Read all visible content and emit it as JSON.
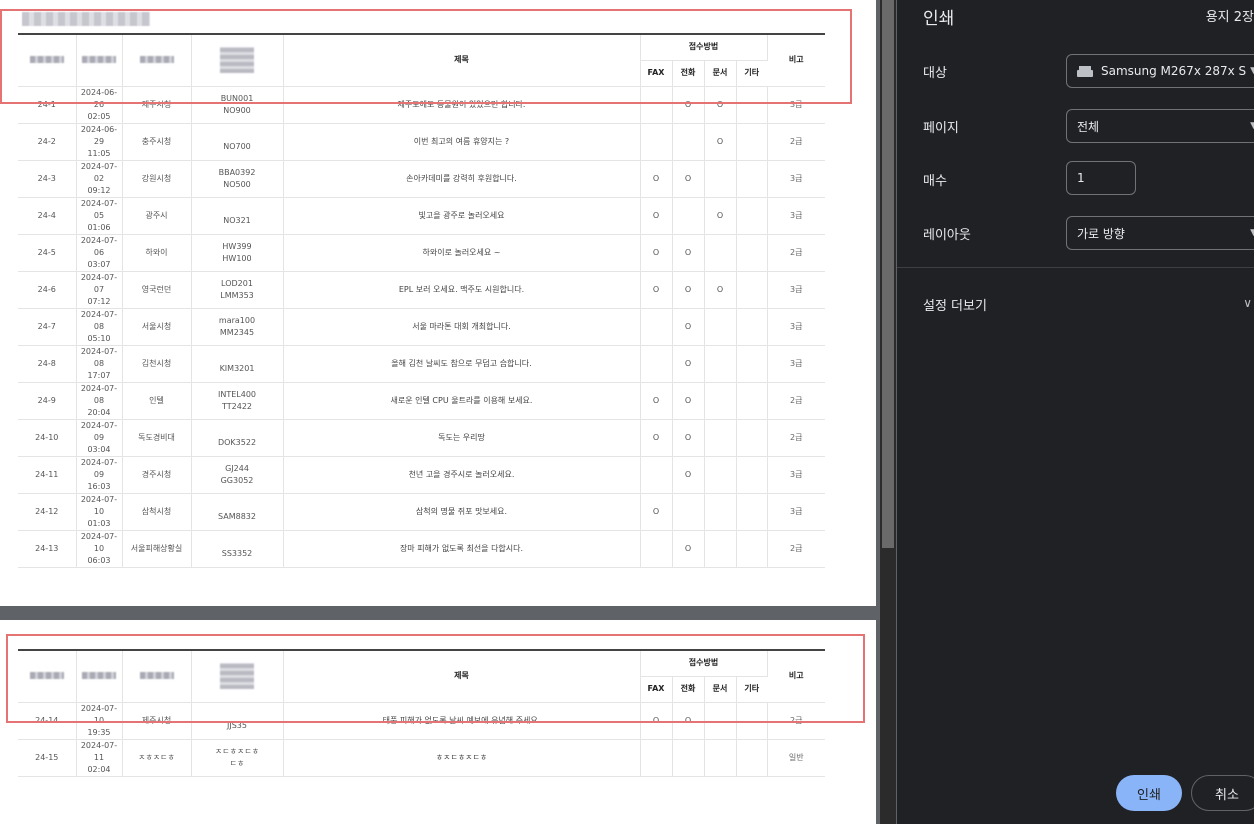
{
  "document": {
    "columns": {
      "title": "제목",
      "receipt_method": "접수방법",
      "methods": [
        "FAX",
        "전화",
        "문서",
        "기타"
      ],
      "note": "비고"
    },
    "rows_page1": [
      {
        "no": "24-1",
        "date": "2024-06-26",
        "time": "02:05",
        "org": "제주시청",
        "code1": "BUN001",
        "code2": "NO900",
        "title": "제주도에도 동물원이 있었으면 합니다.",
        "fax": "",
        "tel": "O",
        "doc": "O",
        "etc": "",
        "grade": "3급"
      },
      {
        "no": "24-2",
        "date": "2024-06-29",
        "time": "11:05",
        "org": "충주시청",
        "code1": "",
        "code2": "NO700",
        "title": "이번 최고의 여름 휴양지는 ?",
        "fax": "",
        "tel": "",
        "doc": "O",
        "etc": "",
        "grade": "2급"
      },
      {
        "no": "24-3",
        "date": "2024-07-02",
        "time": "09:12",
        "org": "강원시청",
        "code1": "BBA0392",
        "code2": "NO500",
        "title": "손아카데미를 강력히 후원합니다.",
        "fax": "O",
        "tel": "O",
        "doc": "",
        "etc": "",
        "grade": "3급"
      },
      {
        "no": "24-4",
        "date": "2024-07-05",
        "time": "01:06",
        "org": "광주시",
        "code1": "",
        "code2": "NO321",
        "title": "빛고을 광주로 놀러오세요",
        "fax": "O",
        "tel": "",
        "doc": "O",
        "etc": "",
        "grade": "3급"
      },
      {
        "no": "24-5",
        "date": "2024-07-06",
        "time": "03:07",
        "org": "하와이",
        "code1": "HW399",
        "code2": "HW100",
        "title": "하와이로 놀러오세요 ~",
        "fax": "O",
        "tel": "O",
        "doc": "",
        "etc": "",
        "grade": "2급"
      },
      {
        "no": "24-6",
        "date": "2024-07-07",
        "time": "07:12",
        "org": "영국런던",
        "code1": "LOD201",
        "code2": "LMM353",
        "title": "EPL 보러 오세요. 맥주도 시원합니다.",
        "fax": "O",
        "tel": "O",
        "doc": "O",
        "etc": "",
        "grade": "3급"
      },
      {
        "no": "24-7",
        "date": "2024-07-08",
        "time": "05:10",
        "org": "서울시청",
        "code1": "mara100",
        "code2": "MM2345",
        "title": "서울 마라톤 대회 개최합니다.",
        "fax": "",
        "tel": "O",
        "doc": "",
        "etc": "",
        "grade": "3급"
      },
      {
        "no": "24-8",
        "date": "2024-07-08",
        "time": "17:07",
        "org": "김천시청",
        "code1": "",
        "code2": "KIM3201",
        "title": "올해 김천 날씨도 참으로 무덥고 습합니다.",
        "fax": "",
        "tel": "O",
        "doc": "",
        "etc": "",
        "grade": "3급"
      },
      {
        "no": "24-9",
        "date": "2024-07-08",
        "time": "20:04",
        "org": "인텔",
        "code1": "INTEL400",
        "code2": "TT2422",
        "title": "새로운 인텔 CPU 울트라를 이용해 보세요.",
        "fax": "O",
        "tel": "O",
        "doc": "",
        "etc": "",
        "grade": "2급"
      },
      {
        "no": "24-10",
        "date": "2024-07-09",
        "time": "03:04",
        "org": "독도경비대",
        "code1": "",
        "code2": "DOK3522",
        "title": "독도는 우리땅",
        "fax": "O",
        "tel": "O",
        "doc": "",
        "etc": "",
        "grade": "2급"
      },
      {
        "no": "24-11",
        "date": "2024-07-09",
        "time": "16:03",
        "org": "경주시청",
        "code1": "GJ244",
        "code2": "GG3052",
        "title": "천년 고을 경주시로 놀러오세요.",
        "fax": "",
        "tel": "O",
        "doc": "",
        "etc": "",
        "grade": "3급"
      },
      {
        "no": "24-12",
        "date": "2024-07-10",
        "time": "01:03",
        "org": "삼척시청",
        "code1": "",
        "code2": "SAM8832",
        "title": "삼척의 명물 쥐포 맛보세요.",
        "fax": "O",
        "tel": "",
        "doc": "",
        "etc": "",
        "grade": "3급"
      },
      {
        "no": "24-13",
        "date": "2024-07-10",
        "time": "06:03",
        "org": "서울피해상황실",
        "code1": "",
        "code2": "SS3352",
        "title": "장마 피해가 없도록 최선을 다합시다.",
        "fax": "",
        "tel": "O",
        "doc": "",
        "etc": "",
        "grade": "2급"
      }
    ],
    "rows_page2": [
      {
        "no": "24-14",
        "date": "2024-07-10",
        "time": "19:35",
        "org": "제주시청",
        "code1": "",
        "code2": "JJS35",
        "title": "태풍 피해가 없도록 날씨 예보에 유념해 주세요.",
        "fax": "O",
        "tel": "O",
        "doc": "",
        "etc": "",
        "grade": "2급"
      },
      {
        "no": "24-15",
        "date": "2024-07-11",
        "time": "02:04",
        "org": "ㅈㅎㅈㄷㅎ",
        "code1": "ㅈㄷㅎㅈㄷㅎ",
        "code2": "ㄷㅎ",
        "title": "ㅎㅈㄷㅎㅈㄷㅎ",
        "fax": "",
        "tel": "",
        "doc": "",
        "etc": "",
        "grade": "일반"
      }
    ]
  },
  "print_panel": {
    "title": "인쇄",
    "sheets": "용지 2장",
    "destination_label": "대상",
    "destination_value": "Samsung M267x 287x S",
    "pages_label": "페이지",
    "pages_value": "전체",
    "copies_label": "매수",
    "copies_value": "1",
    "layout_label": "레이아웃",
    "layout_value": "가로 방향",
    "more_settings": "설정 더보기",
    "print_button": "인쇄",
    "cancel_button": "취소"
  },
  "colors": {
    "panel_bg": "#202124",
    "accent": "#8ab4f8",
    "highlight": "#e57373"
  }
}
